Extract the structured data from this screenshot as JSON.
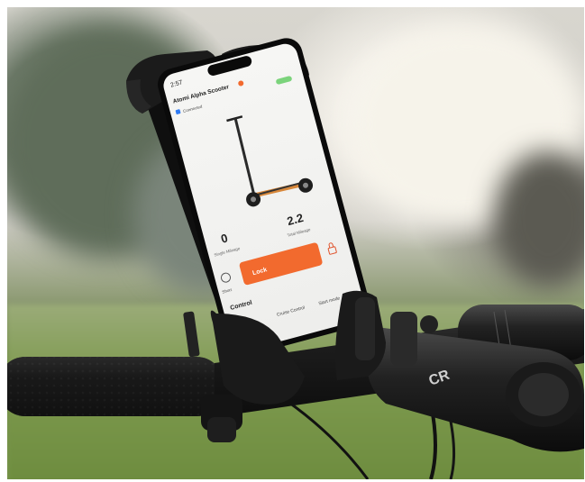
{
  "app": {
    "time": "2:57",
    "title": "Atomi Alpha Scooter",
    "connection_status": "Connected",
    "stats": {
      "single_mileage_value": "0",
      "single_mileage_label": "Single Mileage",
      "total_mileage_value": "2.2",
      "total_mileage_label": "Total Mileage"
    },
    "lock_label": "Lock",
    "shortcut_label": "Short",
    "control_heading": "Control",
    "control_items": [
      "ight",
      "Cruise Control",
      "Start mode"
    ]
  },
  "icons": [
    "bike-handlebar",
    "phone-holder-clamp",
    "scooter-image",
    "speedometer-icon",
    "lock-icon",
    "verified-badge-icon"
  ],
  "colors": {
    "accent_orange": "#f26a2e",
    "holder_black": "#1a1a1a",
    "handlebar_black": "#141414"
  }
}
